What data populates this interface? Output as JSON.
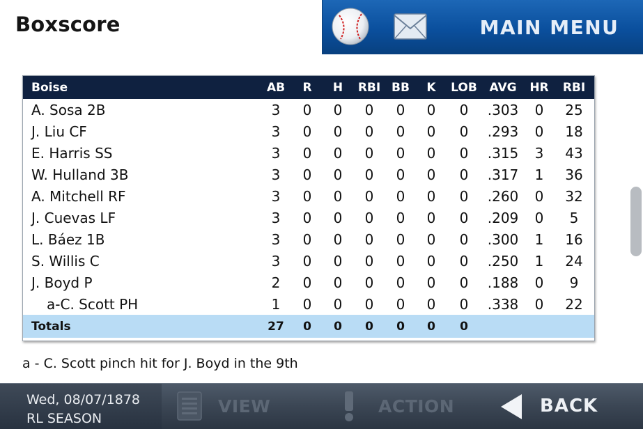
{
  "header": {
    "title": "Boxscore",
    "main_menu_label": "MAIN MENU",
    "icons": [
      "baseball-icon",
      "envelope-icon"
    ]
  },
  "boxscore": {
    "columns": [
      "Boise",
      "AB",
      "R",
      "H",
      "RBI",
      "BB",
      "K",
      "LOB",
      "AVG",
      "HR",
      "RBI"
    ],
    "rows": [
      {
        "player": "A. Sosa 2B",
        "sub": false,
        "stats": [
          "3",
          "0",
          "0",
          "0",
          "0",
          "0",
          "0",
          ".303",
          "0",
          "25"
        ]
      },
      {
        "player": "J. Liu CF",
        "sub": false,
        "stats": [
          "3",
          "0",
          "0",
          "0",
          "0",
          "0",
          "0",
          ".293",
          "0",
          "18"
        ]
      },
      {
        "player": "E. Harris SS",
        "sub": false,
        "stats": [
          "3",
          "0",
          "0",
          "0",
          "0",
          "0",
          "0",
          ".315",
          "3",
          "43"
        ]
      },
      {
        "player": "W. Hulland 3B",
        "sub": false,
        "stats": [
          "3",
          "0",
          "0",
          "0",
          "0",
          "0",
          "0",
          ".317",
          "1",
          "36"
        ]
      },
      {
        "player": "A. Mitchell RF",
        "sub": false,
        "stats": [
          "3",
          "0",
          "0",
          "0",
          "0",
          "0",
          "0",
          ".260",
          "0",
          "32"
        ]
      },
      {
        "player": "J. Cuevas LF",
        "sub": false,
        "stats": [
          "3",
          "0",
          "0",
          "0",
          "0",
          "0",
          "0",
          ".209",
          "0",
          "5"
        ]
      },
      {
        "player": "L. Báez 1B",
        "sub": false,
        "stats": [
          "3",
          "0",
          "0",
          "0",
          "0",
          "0",
          "0",
          ".300",
          "1",
          "16"
        ]
      },
      {
        "player": "S. Willis C",
        "sub": false,
        "stats": [
          "3",
          "0",
          "0",
          "0",
          "0",
          "0",
          "0",
          ".250",
          "1",
          "24"
        ]
      },
      {
        "player": "J. Boyd P",
        "sub": false,
        "stats": [
          "2",
          "0",
          "0",
          "0",
          "0",
          "0",
          "0",
          ".188",
          "0",
          "9"
        ]
      },
      {
        "player": "a-C. Scott PH",
        "sub": true,
        "stats": [
          "1",
          "0",
          "0",
          "0",
          "0",
          "0",
          "0",
          ".338",
          "0",
          "22"
        ]
      }
    ],
    "totals": {
      "label": "Totals",
      "stats": [
        "27",
        "0",
        "0",
        "0",
        "0",
        "0",
        "0",
        "",
        "",
        ""
      ]
    }
  },
  "footnote": "a - C. Scott pinch hit for J. Boyd in the 9th",
  "bottom_bar": {
    "date": "Wed, 08/07/1878",
    "season": "RL SEASON",
    "view_label": "VIEW",
    "action_label": "ACTION",
    "back_label": "BACK",
    "icons": [
      "list-icon",
      "exclamation-icon",
      "back-arrow-icon"
    ]
  },
  "colors": {
    "header_blue": "#0a4f9d",
    "table_header": "#0f2140",
    "totals_row": "#b9dcf5",
    "bottom_bar": "#3b4654",
    "disabled_label": "#5c6775"
  }
}
